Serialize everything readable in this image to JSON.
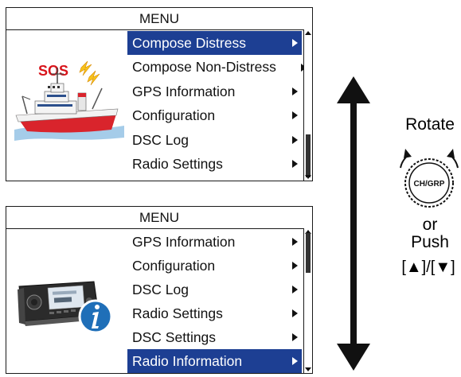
{
  "screen_top": {
    "title": "MENU",
    "items": [
      {
        "label": "Compose Distress",
        "selected": true
      },
      {
        "label": "Compose Non-Distress",
        "selected": false
      },
      {
        "label": "GPS Information",
        "selected": false
      },
      {
        "label": "Configuration",
        "selected": false
      },
      {
        "label": "DSC Log",
        "selected": false
      },
      {
        "label": "Radio Settings",
        "selected": false
      }
    ],
    "sos_label": "SOS"
  },
  "screen_bottom": {
    "title": "MENU",
    "items": [
      {
        "label": "GPS Information",
        "selected": false
      },
      {
        "label": "Configuration",
        "selected": false
      },
      {
        "label": "DSC Log",
        "selected": false
      },
      {
        "label": "Radio Settings",
        "selected": false
      },
      {
        "label": "DSC Settings",
        "selected": false
      },
      {
        "label": "Radio Information",
        "selected": true
      }
    ]
  },
  "knob": {
    "rotate_label": "Rotate",
    "button_label": "CH/GRP",
    "or_label": "or",
    "push_label": "Push",
    "keys_label": "[▲]/[▼]"
  },
  "colors": {
    "selection": "#1d3f93",
    "sos_red": "#d8141b",
    "info_blue": "#1f6fb8"
  }
}
